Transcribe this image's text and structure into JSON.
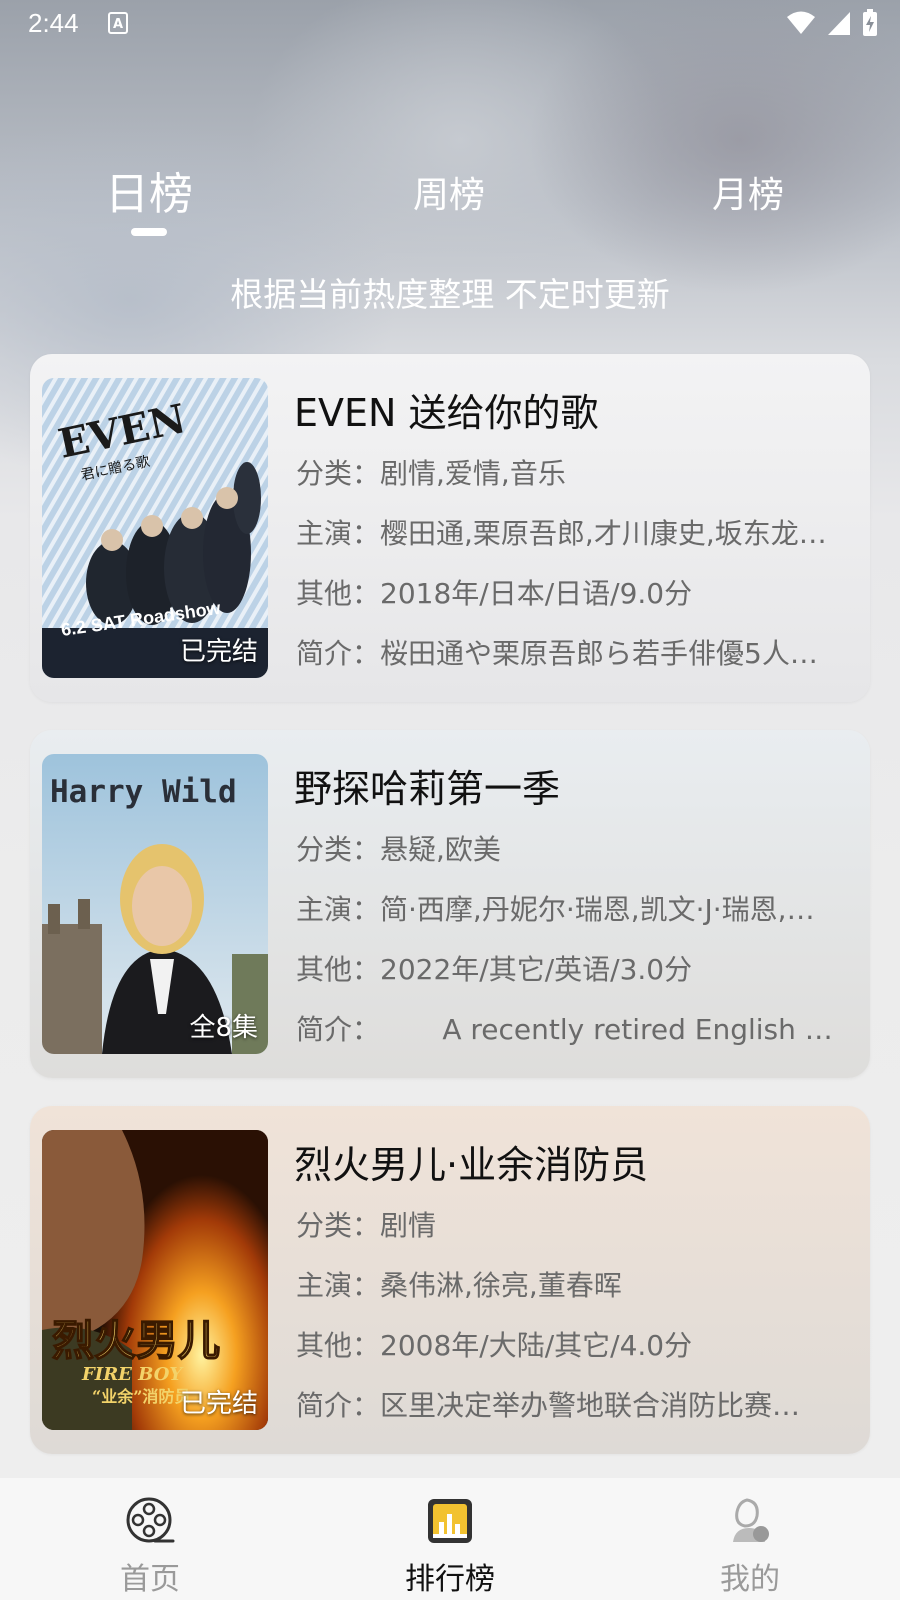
{
  "status_bar": {
    "time": "2:44",
    "a_icon": "A"
  },
  "tabs": [
    {
      "label": "日榜",
      "active": true
    },
    {
      "label": "周榜",
      "active": false
    },
    {
      "label": "月榜",
      "active": false
    }
  ],
  "subtitle": "根据当前热度整理 不定时更新",
  "items": [
    {
      "title": "EVEN 送给你的歌",
      "badge": "已完结",
      "genre_label": "分类：",
      "genre": "剧情,爱情,音乐",
      "cast_label": "主演：",
      "cast": "樱田通,栗原吾郎,才川康史,坂东龙…",
      "other_label": "其他：",
      "other": "2018年/日本/日语/9.0分",
      "intro_label": "简介：",
      "intro": "桜田通や栗原吾郎ら若手俳優5人…",
      "poster_text": [
        "EVEN",
        "君に贈る歌",
        "6.2 SAT Roadshow"
      ]
    },
    {
      "title": "野探哈莉第一季",
      "badge": "全8集",
      "genre_label": "分类：",
      "genre": "悬疑,欧美",
      "cast_label": "主演：",
      "cast": "简·西摩,丹妮尔·瑞恩,凯文·J·瑞恩,…",
      "other_label": "其他：",
      "other": "2022年/其它/英语/3.0分",
      "intro_label": "简介：",
      "intro": "       A recently retired English pro…",
      "poster_text": [
        "Harry Wild"
      ]
    },
    {
      "title": "烈火男儿·业余消防员",
      "badge": "已完结",
      "genre_label": "分类：",
      "genre": "剧情",
      "cast_label": "主演：",
      "cast": "桑伟淋,徐亮,董春晖",
      "other_label": "其他：",
      "other": "2008年/大陆/其它/4.0分",
      "intro_label": "简介：",
      "intro": "区里决定举办警地联合消防比赛…",
      "poster_text": [
        "烈火男儿",
        "FIRE BOY",
        "“业余”消防员"
      ]
    }
  ],
  "bottom_nav": [
    {
      "label": "首页",
      "icon": "film-reel-icon",
      "active": false
    },
    {
      "label": "排行榜",
      "icon": "ranking-chart-icon",
      "active": true
    },
    {
      "label": "我的",
      "icon": "profile-icon",
      "active": false
    }
  ],
  "colors": {
    "active_nav": "#111111",
    "inactive_nav": "#9a9a9a",
    "rank_icon": "#f2c230"
  }
}
